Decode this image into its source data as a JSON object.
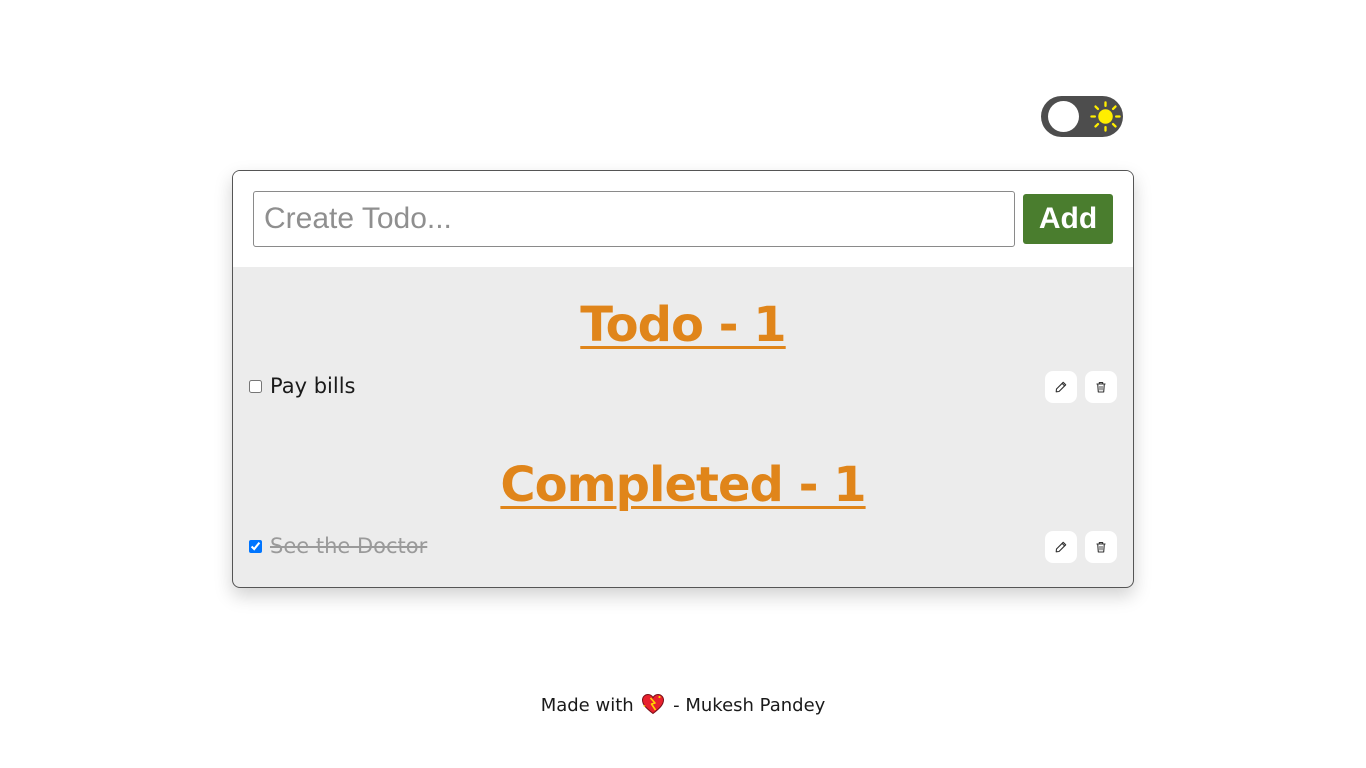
{
  "theme_toggle": {
    "state": "light",
    "icon": "sun-icon",
    "knob_color": "#ffffff",
    "track_color": "#4d4d4d",
    "sun_color": "#ffee00"
  },
  "create_form": {
    "placeholder": "Create Todo...",
    "value": "",
    "add_label": "Add",
    "add_color": "#4a7d2e"
  },
  "sections": {
    "todo": {
      "heading": "Todo - 1",
      "items": [
        {
          "text": "Pay bills",
          "checked": false,
          "edit_icon": "pencil-icon",
          "delete_icon": "trash-icon"
        }
      ]
    },
    "completed": {
      "heading": "Completed - 1",
      "items": [
        {
          "text": "See the Doctor",
          "checked": true,
          "edit_icon": "pencil-icon",
          "delete_icon": "trash-icon"
        }
      ]
    }
  },
  "accent_color": "#e0851a",
  "footer": {
    "prefix": "Made with",
    "icon": "heart-icon",
    "suffix": "- Mukesh Pandey"
  }
}
